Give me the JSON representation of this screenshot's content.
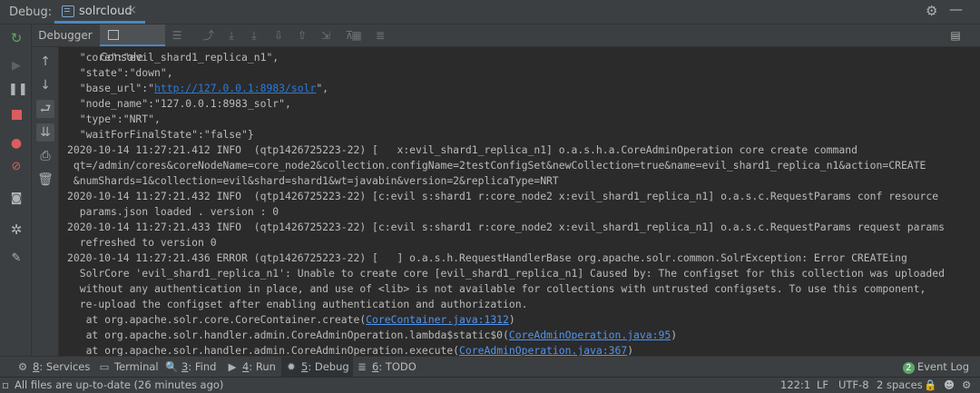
{
  "header": {
    "debug_label": "Debug:",
    "session_tab": "solrcloud",
    "close_glyph": "×"
  },
  "subtabs": {
    "debugger": "Debugger",
    "console": "Console"
  },
  "console_lines": [
    {
      "text": "  \"core\":\"evil_shard1_replica_n1\","
    },
    {
      "text": "  \"state\":\"down\","
    },
    {
      "pre": "  \"base_url\":\"",
      "link": "http://127.0.0.1:8983/solr",
      "post": "\","
    },
    {
      "text": "  \"node_name\":\"127.0.0.1:8983_solr\","
    },
    {
      "text": "  \"type\":\"NRT\","
    },
    {
      "text": "  \"waitForFinalState\":\"false\"}"
    },
    {
      "text": "2020-10-14 11:27:21.412 INFO  (qtp1426725223-22) [   x:evil_shard1_replica_n1] o.a.s.h.a.CoreAdminOperation core create command"
    },
    {
      "text": " qt=/admin/cores&coreNodeName=core_node2&collection.configName=2testConfigSet&newCollection=true&name=evil_shard1_replica_n1&action=CREATE"
    },
    {
      "text": " &numShards=1&collection=evil&shard=shard1&wt=javabin&version=2&replicaType=NRT"
    },
    {
      "text": "2020-10-14 11:27:21.432 INFO  (qtp1426725223-22) [c:evil s:shard1 r:core_node2 x:evil_shard1_replica_n1] o.a.s.c.RequestParams conf resource"
    },
    {
      "text": "  params.json loaded . version : 0"
    },
    {
      "text": "2020-10-14 11:27:21.433 INFO  (qtp1426725223-22) [c:evil s:shard1 r:core_node2 x:evil_shard1_replica_n1] o.a.s.c.RequestParams request params"
    },
    {
      "text": "  refreshed to version 0"
    },
    {
      "text": "2020-10-14 11:27:21.436 ERROR (qtp1426725223-22) [   ] o.a.s.h.RequestHandlerBase org.apache.solr.common.SolrException: Error CREATEing"
    },
    {
      "text": "  SolrCore 'evil_shard1_replica_n1': Unable to create core [evil_shard1_replica_n1] Caused by: The configset for this collection was uploaded"
    },
    {
      "text": "  without any authentication in place, and use of <lib> is not available for collections with untrusted configsets. To use this component,"
    },
    {
      "text": "  re-upload the configset after enabling authentication and authorization."
    },
    {
      "pre": "   at org.apache.solr.core.CoreContainer.create(",
      "link": "CoreContainer.java:1312",
      "post": ")"
    },
    {
      "pre": "   at org.apache.solr.handler.admin.CoreAdminOperation.lambda$static$0(",
      "link": "CoreAdminOperation.java:95",
      "post": ")"
    },
    {
      "pre": "   at org.apache.solr.handler.admin.CoreAdminOperation.execute(",
      "link": "CoreAdminOperation.java:367",
      "post": ")"
    }
  ],
  "bottom_tabs": [
    {
      "num": "8",
      "label": ": Services",
      "icon": "services-icon"
    },
    {
      "num": "",
      "label": "Terminal",
      "icon": "terminal-icon"
    },
    {
      "num": "3",
      "label": ": Find",
      "icon": "search-icon"
    },
    {
      "num": "4",
      "label": ": Run",
      "icon": "run-icon"
    },
    {
      "num": "5",
      "label": ": Debug",
      "icon": "bug-icon"
    },
    {
      "num": "6",
      "label": ": TODO",
      "icon": "list-icon"
    }
  ],
  "event_log": {
    "count": "2",
    "label": "Event Log"
  },
  "status": {
    "message": "All files are up-to-date (26 minutes ago)",
    "position": "122:1",
    "line_sep": "LF",
    "encoding": "UTF-8",
    "indent": "2 spaces"
  },
  "colors": {
    "background": "#2b2b2b",
    "panel": "#3c3f41",
    "accent": "#4a88c7",
    "link": "#5394ec",
    "green": "#59a869",
    "red": "#db5c5c"
  }
}
